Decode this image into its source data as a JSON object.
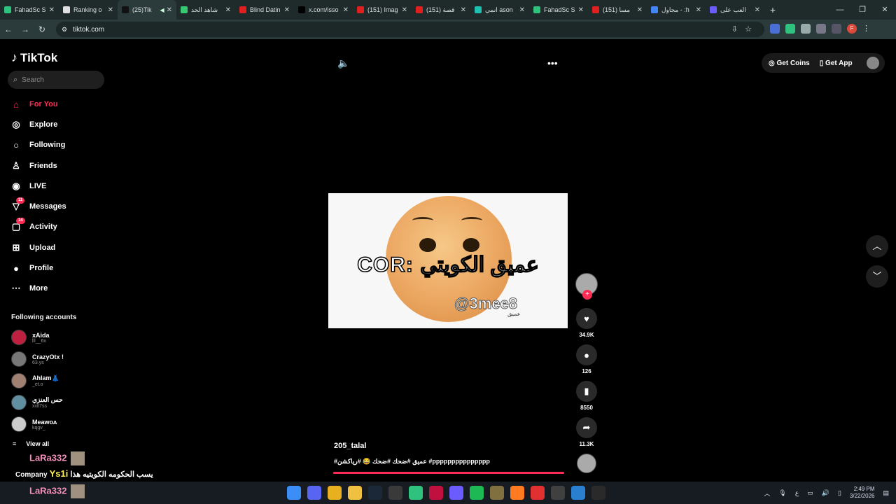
{
  "browser": {
    "tabs": [
      {
        "title": "FahadSc S",
        "color": "#2ec27e"
      },
      {
        "title": "Ranking o",
        "color": "#e0e0e0"
      },
      {
        "title": "(25)Tik",
        "color": "#111111",
        "active": true
      },
      {
        "title": "شاهد الحد",
        "color": "#37c871"
      },
      {
        "title": "Blind Datin",
        "color": "#e02020"
      },
      {
        "title": "x.com/isso",
        "color": "#000000"
      },
      {
        "title": "(151) Imag",
        "color": "#e02020"
      },
      {
        "title": "(151) قصة",
        "color": "#e02020"
      },
      {
        "title": "انمي ason",
        "color": "#20c0b0"
      },
      {
        "title": "FahadSc S",
        "color": "#2ec27e"
      },
      {
        "title": "(151) مسا",
        "color": "#e02020"
      },
      {
        "title": "مجاول - :h",
        "color": "#4285f4"
      },
      {
        "title": "العب على",
        "color": "#6a5cff"
      }
    ],
    "new_tab": "+",
    "url": "tiktok.com"
  },
  "tiktok": {
    "logo": "TikTok",
    "search_placeholder": "Search",
    "nav": [
      {
        "label": "For You",
        "icon": "home-icon",
        "glyph": "⌂",
        "active": true
      },
      {
        "label": "Explore",
        "icon": "compass-icon",
        "glyph": "◎"
      },
      {
        "label": "Following",
        "icon": "following-icon",
        "glyph": "○"
      },
      {
        "label": "Friends",
        "icon": "friends-icon",
        "glyph": "♙"
      },
      {
        "label": "LIVE",
        "icon": "live-icon",
        "glyph": "◉"
      },
      {
        "label": "Messages",
        "icon": "messages-icon",
        "glyph": "▽",
        "badge": "11"
      },
      {
        "label": "Activity",
        "icon": "activity-icon",
        "glyph": "▢",
        "badge": "14"
      },
      {
        "label": "Upload",
        "icon": "upload-icon",
        "glyph": "⊞"
      },
      {
        "label": "Profile",
        "icon": "profile-icon",
        "glyph": "●"
      },
      {
        "label": "More",
        "icon": "more-icon",
        "glyph": "⋯"
      }
    ],
    "following_title": "Following accounts",
    "accounts": [
      {
        "name": "xAida",
        "handle": "lll__6x",
        "color": "#c02040"
      },
      {
        "name": "CrazyOtx !",
        "handle": "63.ys",
        "color": "#777777"
      },
      {
        "name": "Ahlam👗",
        "handle": "_et.o",
        "color": "#a08070"
      },
      {
        "name": "حس العنزي",
        "handle": "xxll7ss",
        "color": "#6090a0"
      },
      {
        "name": "Meawᴏᴀ",
        "handle": "kqgv_",
        "color": "#cccccc"
      }
    ],
    "view_all": "View all",
    "get_coins": "Get Coins",
    "get_app": "Get App",
    "video": {
      "overlay_text": "COR: عميق الكويتي",
      "watermark": "@3mee8",
      "watermark_sub": "عميق"
    },
    "author": "205_talal",
    "caption": "#عميق #ضحك #ضحك 😂 #رياكشن #ppppppppppppppp",
    "likes": "34.9K",
    "comments": "126",
    "saves": "8550",
    "shares": "11.3K"
  },
  "stream_chat": [
    {
      "user": "LaRa332",
      "text": ""
    },
    {
      "user": "Ys1i",
      "prefix": "Company",
      "text": "يسب الحكومه الكويتيه هذا"
    },
    {
      "user": "LaRa332",
      "text": ""
    }
  ],
  "taskbar": {
    "apps": [
      {
        "name": "windows-start-icon",
        "color": "#3a8ef6"
      },
      {
        "name": "discord-icon",
        "color": "#5865f2"
      },
      {
        "name": "chrome-icon",
        "color": "#e8b020"
      },
      {
        "name": "file-explorer-icon",
        "color": "#f0c040"
      },
      {
        "name": "steam-icon",
        "color": "#1b2838"
      },
      {
        "name": "xbox-icon",
        "color": "#3a3a3a"
      },
      {
        "name": "app-icon",
        "color": "#2ec27e"
      },
      {
        "name": "affinity-icon",
        "color": "#c01040"
      },
      {
        "name": "video-app-icon",
        "color": "#6a5cff"
      },
      {
        "name": "spotify-icon",
        "color": "#1db954"
      },
      {
        "name": "folder-icon",
        "color": "#807040"
      },
      {
        "name": "firefox-icon",
        "color": "#ff7a20"
      },
      {
        "name": "red-app-icon",
        "color": "#e03030"
      },
      {
        "name": "clock-app-icon",
        "color": "#404040"
      },
      {
        "name": "shield-app-icon",
        "color": "#2a7fd0"
      },
      {
        "name": "epic-games-icon",
        "color": "#2a2a2a"
      }
    ],
    "lang": "ع",
    "time": "2:49 PM",
    "date": "3/22/2026"
  }
}
